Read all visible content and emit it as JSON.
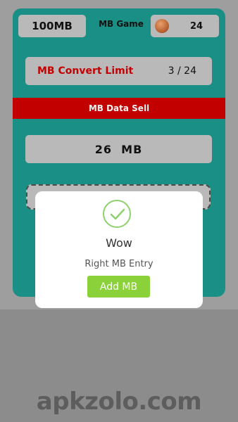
{
  "header": {
    "mb_balance": "100MB",
    "game_label": "MB Game",
    "coin_count": "24"
  },
  "convert_limit": {
    "label": "MB Convert Limit",
    "value": "3 / 24"
  },
  "sell_bar": {
    "label": "MB Data Sell"
  },
  "amount": {
    "value": "26  MB"
  },
  "dialog": {
    "title": "Wow",
    "message": "Right MB Entry",
    "button_label": "Add MB"
  },
  "watermark": "apkzolo.com",
  "colors": {
    "card": "#1a8f86",
    "sell_bar": "#c20000",
    "button": "#8ad13a",
    "limit_text": "#c40000"
  },
  "icons": [
    "coin-icon",
    "check-icon"
  ]
}
